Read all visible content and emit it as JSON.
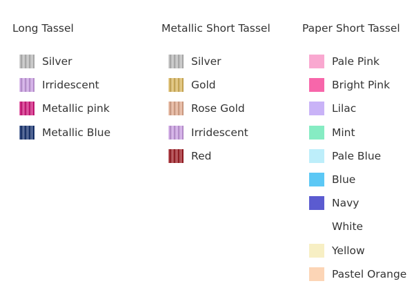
{
  "columns": [
    {
      "title": "Long Tassel",
      "items": [
        {
          "label": "Silver",
          "color": "#b8b8b8",
          "texture": true
        },
        {
          "label": "Irridescent",
          "color": "#c79ae0",
          "texture": true
        },
        {
          "label": "Metallic pink",
          "color": "#d0147a",
          "texture": true
        },
        {
          "label": "Metallic Blue",
          "color": "#14306e",
          "texture": true
        }
      ]
    },
    {
      "title": "Metallic Short Tassel",
      "items": [
        {
          "label": "Silver",
          "color": "#b8b8b8",
          "texture": true
        },
        {
          "label": "Gold",
          "color": "#d8b45a",
          "texture": true
        },
        {
          "label": "Rose Gold",
          "color": "#e0a88c",
          "texture": true
        },
        {
          "label": "Irridescent",
          "color": "#c79ae0",
          "texture": true
        },
        {
          "label": "Red",
          "color": "#9c1a22",
          "texture": true
        }
      ]
    },
    {
      "title": "Paper Short Tassel",
      "items": [
        {
          "label": "Pale Pink",
          "color": "#f9a8d0",
          "texture": false
        },
        {
          "label": "Bright Pink",
          "color": "#f766aa",
          "texture": false
        },
        {
          "label": "Lilac",
          "color": "#c9b3f7",
          "texture": false
        },
        {
          "label": "Mint",
          "color": "#86ecc3",
          "texture": false
        },
        {
          "label": "Pale Blue",
          "color": "#bdeefa",
          "texture": false
        },
        {
          "label": "Blue",
          "color": "#5cc8f5",
          "texture": false
        },
        {
          "label": "Navy",
          "color": "#5b5bd0",
          "texture": false
        },
        {
          "label": "White",
          "color": "#ffffff",
          "texture": false
        },
        {
          "label": "Yellow",
          "color": "#f7efc4",
          "texture": false
        },
        {
          "label": "Pastel Orange",
          "color": "#fcd5b6",
          "texture": false
        }
      ]
    }
  ]
}
